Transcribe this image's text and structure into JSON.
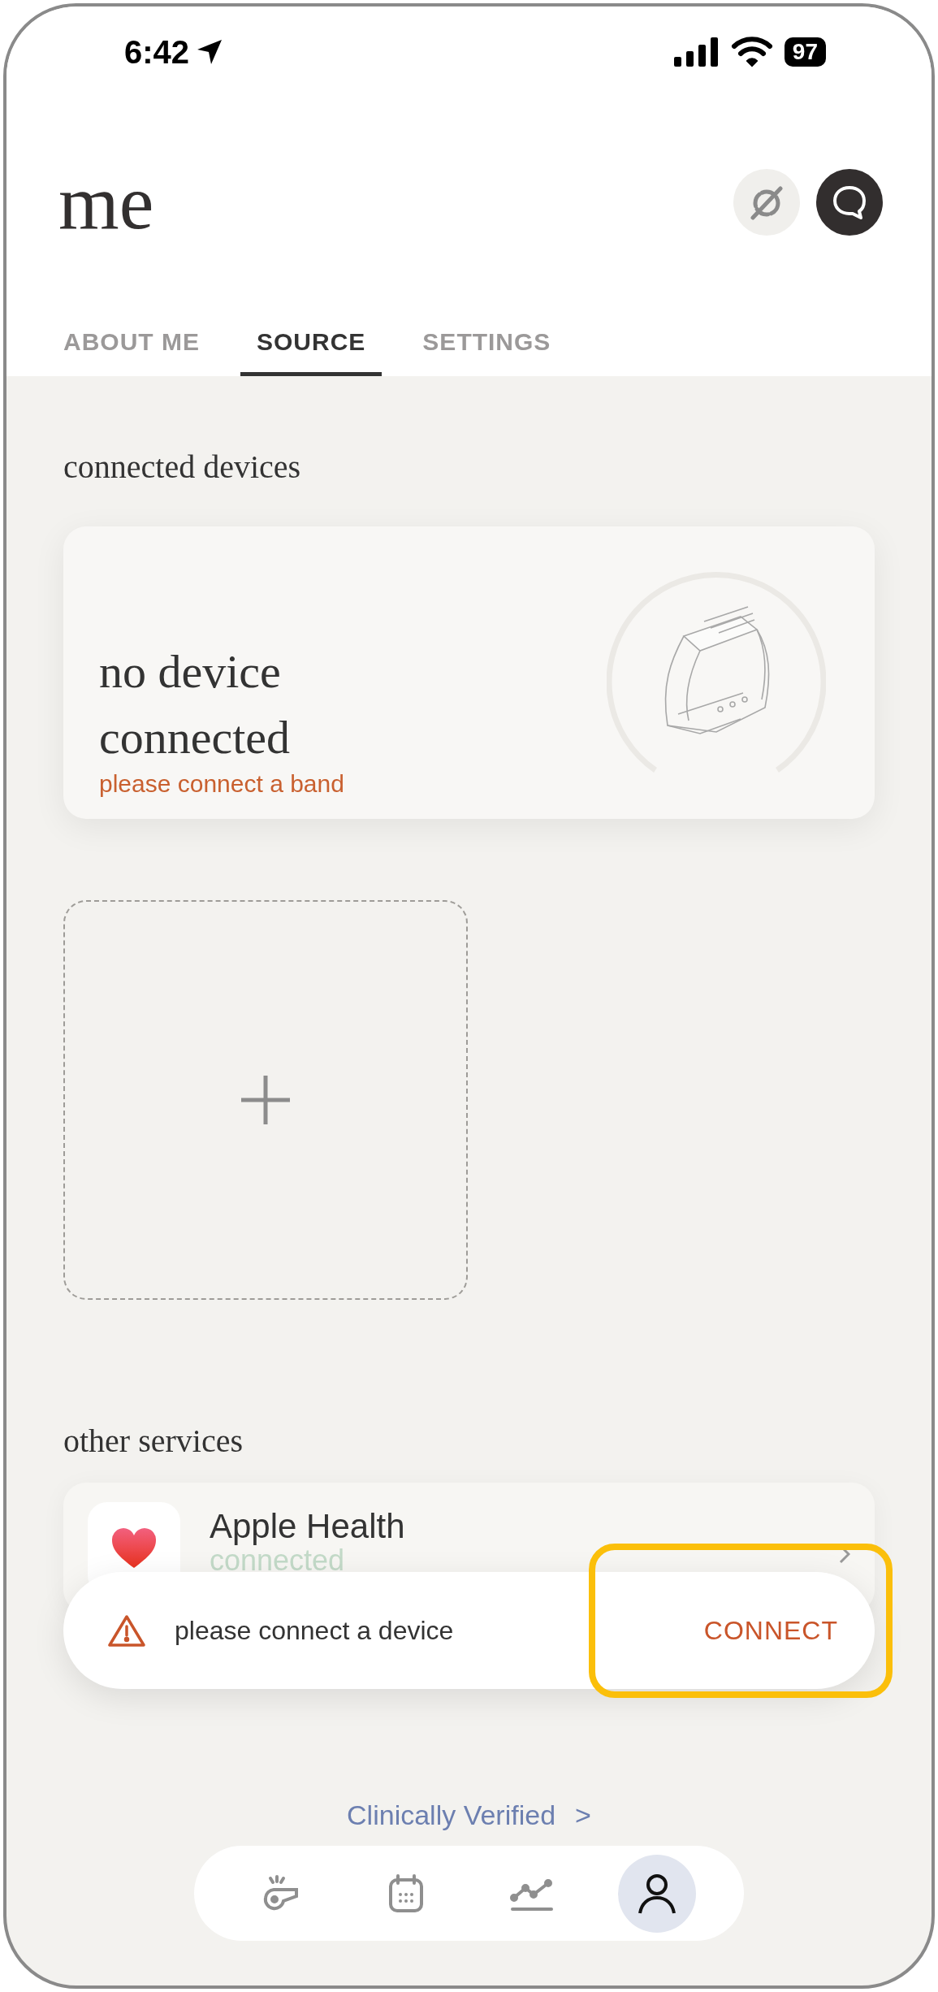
{
  "status_bar": {
    "time": "6:42",
    "battery": "97"
  },
  "header": {
    "title": "me"
  },
  "tabs": [
    {
      "label": "ABOUT ME",
      "selected": false
    },
    {
      "label": "SOURCE",
      "selected": true
    },
    {
      "label": "SETTINGS",
      "selected": false
    }
  ],
  "connected_devices": {
    "heading": "connected devices",
    "device_card": {
      "title": "no device connected",
      "subtitle": "please connect a band"
    }
  },
  "other_services": {
    "heading": "other services",
    "services": [
      {
        "name": "Apple Health",
        "status": "connected"
      }
    ]
  },
  "toast": {
    "message": "please connect a device",
    "action": {
      "label": "CONNECT",
      "highlighted": true
    }
  },
  "footer_link": {
    "label": "Clinically Verified",
    "chevron": ">"
  },
  "bottom_nav": [
    {
      "kind": "whistle",
      "selected": false
    },
    {
      "kind": "calendar",
      "selected": false
    },
    {
      "kind": "trend",
      "selected": false
    },
    {
      "kind": "profile",
      "selected": true
    }
  ]
}
